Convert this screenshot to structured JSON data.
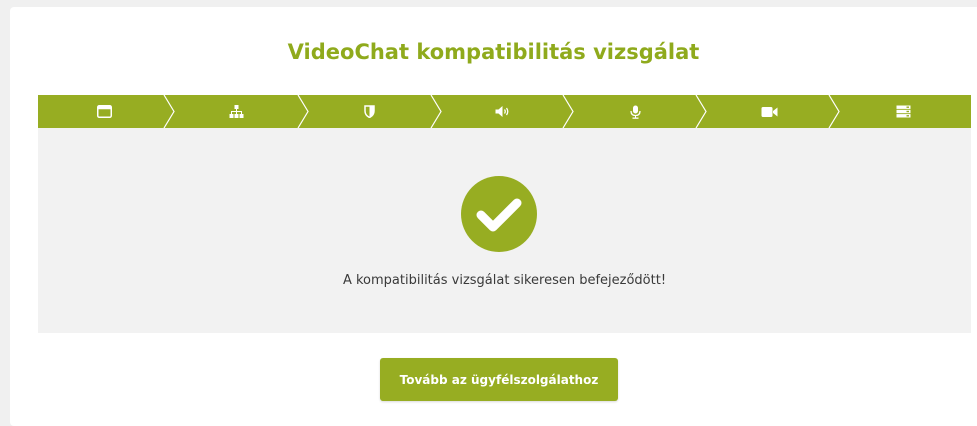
{
  "title": "VideoChat kompatibilitás vizsgálat",
  "steps": [
    {
      "icon": "browser-window-icon"
    },
    {
      "icon": "network-icon"
    },
    {
      "icon": "shield-icon"
    },
    {
      "icon": "speaker-icon"
    },
    {
      "icon": "microphone-icon"
    },
    {
      "icon": "video-camera-icon"
    },
    {
      "icon": "server-icon"
    }
  ],
  "result": {
    "icon": "checkmark-circle-icon",
    "message": "A kompatibilitás vizsgálat sikeresen befejeződött!"
  },
  "continue_button": {
    "label": "Tovább az ügyfélszolgálathoz"
  },
  "colors": {
    "accent": "#97ad22",
    "title": "#8faa1c",
    "panel": "#f2f2f2"
  }
}
